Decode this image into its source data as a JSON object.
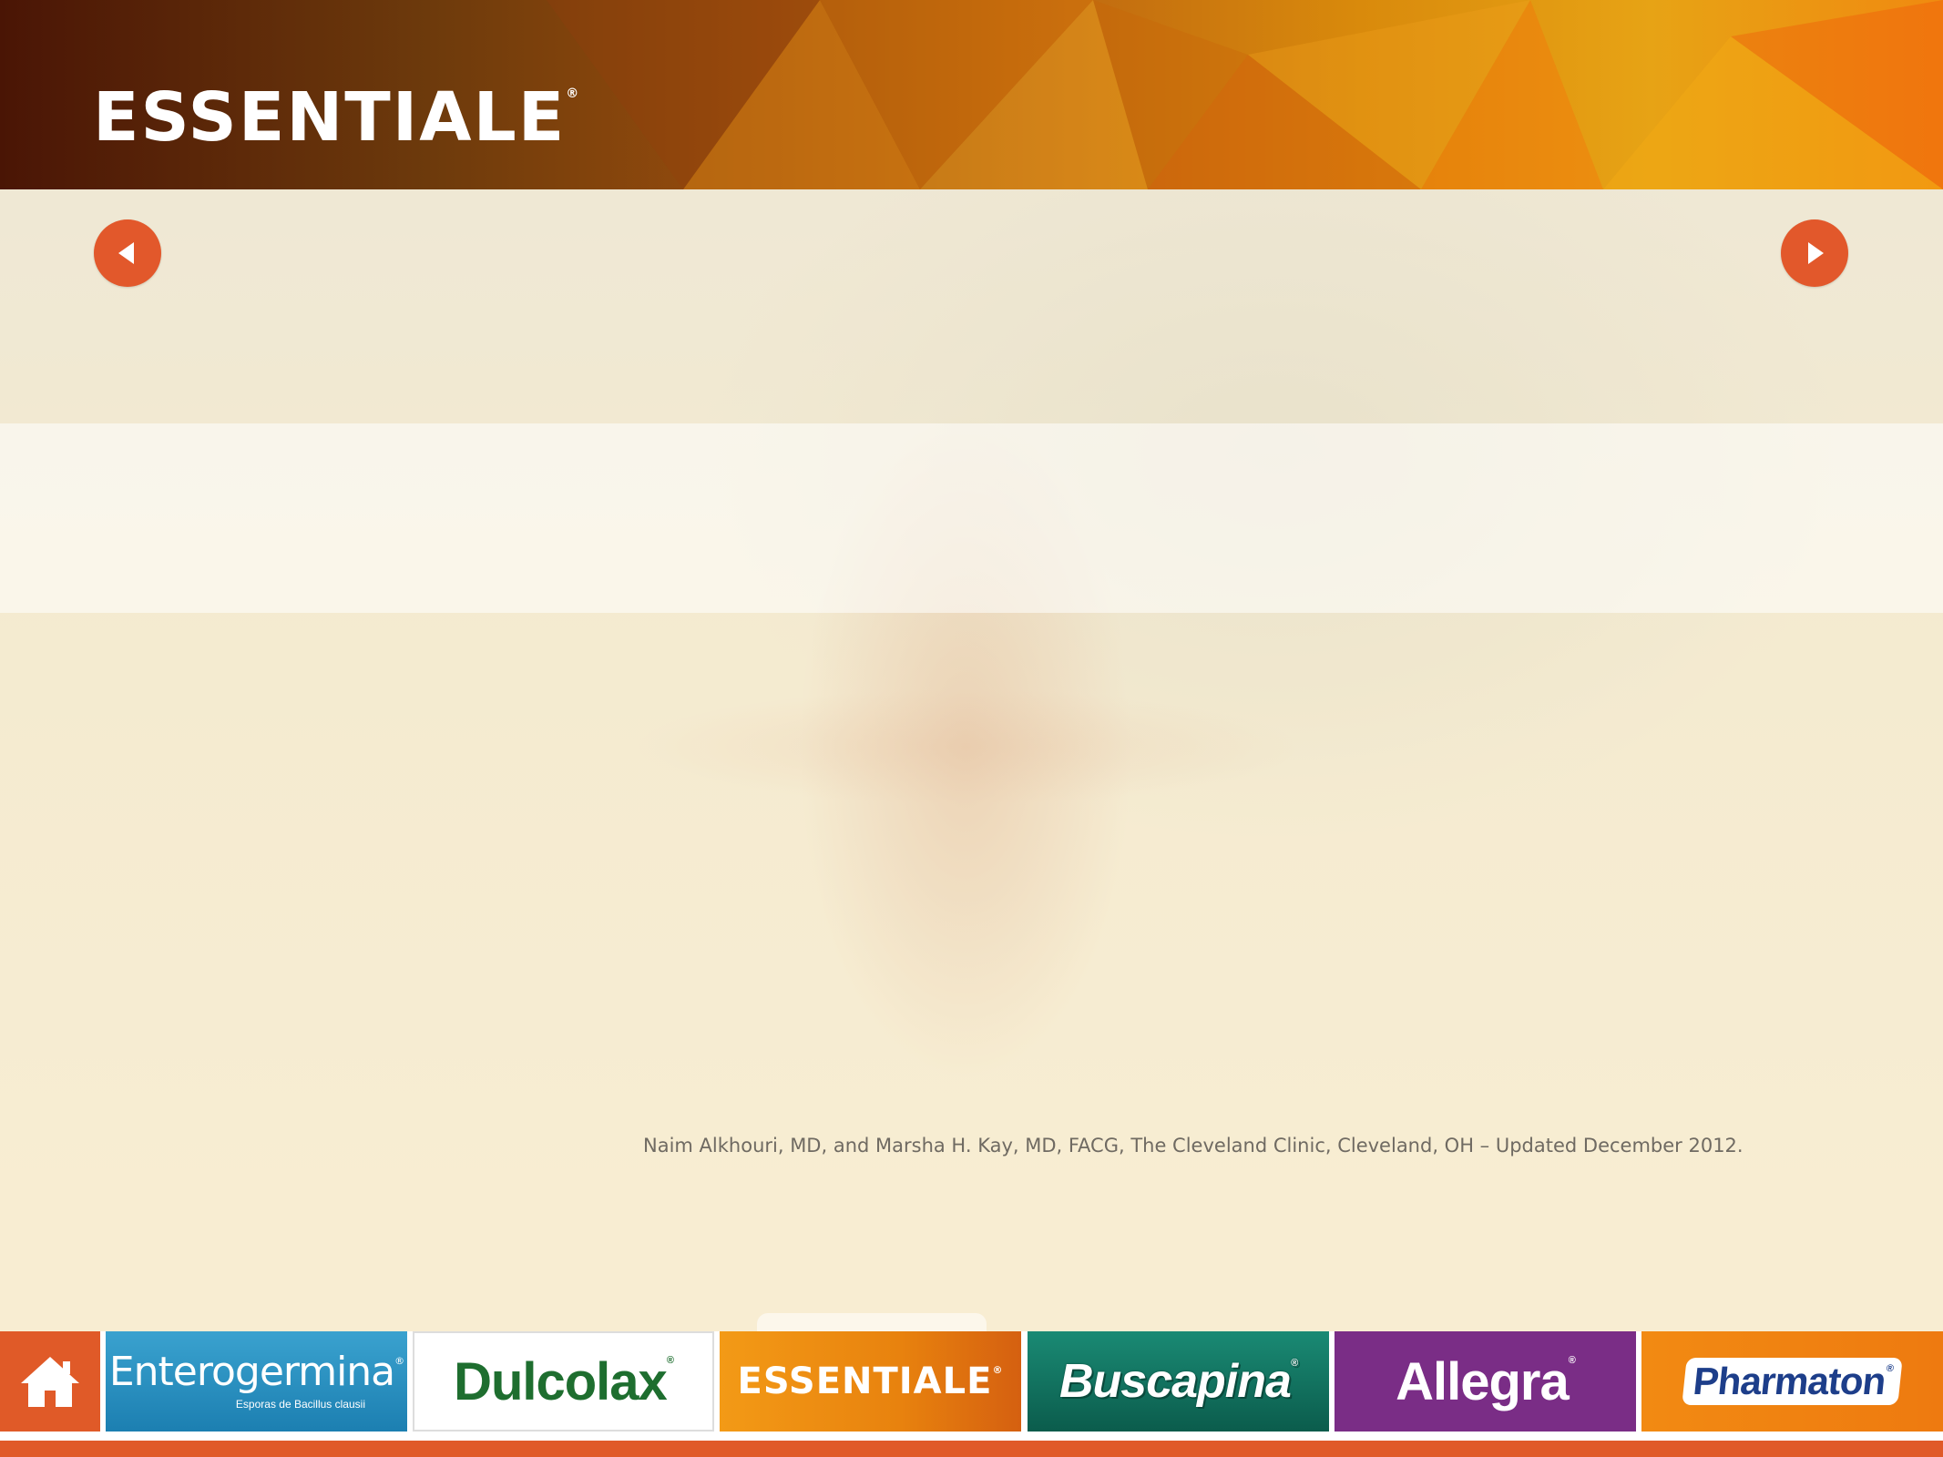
{
  "header": {
    "brand": "ESSENTIALE",
    "brand_mark": "®"
  },
  "nav": {
    "prev_icon": "triangle-left-icon",
    "next_icon": "triangle-right-icon"
  },
  "content": {
    "footnote": "Naim Alkhouri, MD, and Marsha H. Kay, MD, FACG, The Cleveland Clinic, Cleveland, OH – Updated December 2012."
  },
  "bottom_nav": {
    "home_icon": "house-icon",
    "items": [
      {
        "label": "Enterogermina",
        "mark": "®",
        "sub": "Esporas de Bacillus clausii",
        "color": "#2a92c2"
      },
      {
        "label": "Dulcolax",
        "mark": "®",
        "color": "#1e6e2f"
      },
      {
        "label": "ESSENTIALE",
        "mark": "®",
        "color": "#ee8a12"
      },
      {
        "label": "Buscapina",
        "mark": "®",
        "color": "#137564"
      },
      {
        "label": "Allegra",
        "mark": "®",
        "color": "#7a2d86"
      },
      {
        "label": "Pharmaton",
        "mark": "®",
        "color": "#f08212"
      }
    ]
  },
  "colors": {
    "accent": "#e05a28"
  }
}
